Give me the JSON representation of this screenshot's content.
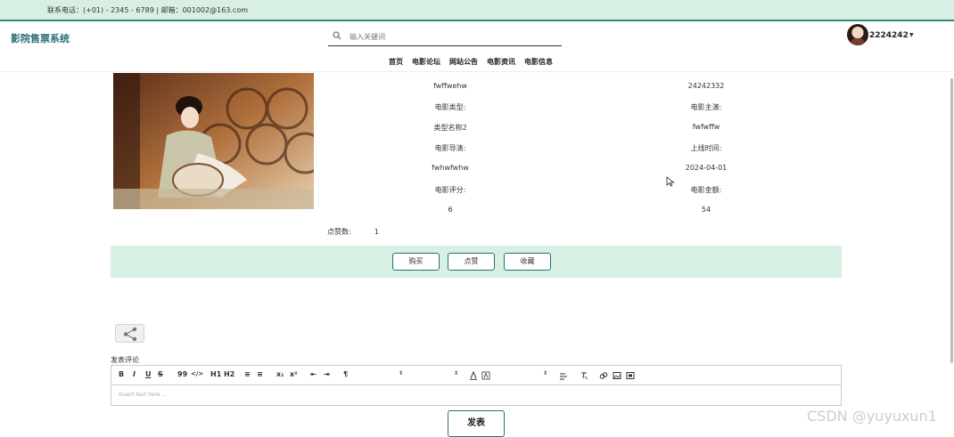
{
  "topbar": {
    "contact": "联系电话：(+01) - 2345 - 6789 | 邮箱：001002@163.com"
  },
  "header": {
    "logo": "影院售票系统",
    "search_placeholder": "输入关键词",
    "username": "2224242"
  },
  "nav": [
    "首页",
    "电影论坛",
    "网站公告",
    "电影资讯",
    "电影信息"
  ],
  "detail": {
    "left": [
      "fwffwehw",
      "电影类型:",
      "类型名称2",
      "电影导演:",
      "fwhwfwhw",
      "电影评分:",
      "6"
    ],
    "right": [
      "24242332",
      "电影主演:",
      "fwfwffw",
      "上线时间:",
      "2024-04-01",
      "电影金额:",
      "54"
    ],
    "like_label": "点赞数:",
    "like_value": "1"
  },
  "actions": {
    "buy": "购买",
    "like": "点赞",
    "favorite": "收藏"
  },
  "comment": {
    "label": "发表评论",
    "placeholder": "Insert text here ...",
    "submit": "发表"
  },
  "toolbar": [
    "B",
    "I",
    "U",
    "S",
    "99",
    "</>",
    "H1",
    "H2",
    "≡",
    "≡",
    "x₁",
    "x²",
    "⇤",
    "⇥",
    "¶"
  ],
  "watermark": "CSDN @yuyuxun1",
  "colors": {
    "accent": "#2c6e74",
    "bar_bg": "#d8efe3"
  }
}
